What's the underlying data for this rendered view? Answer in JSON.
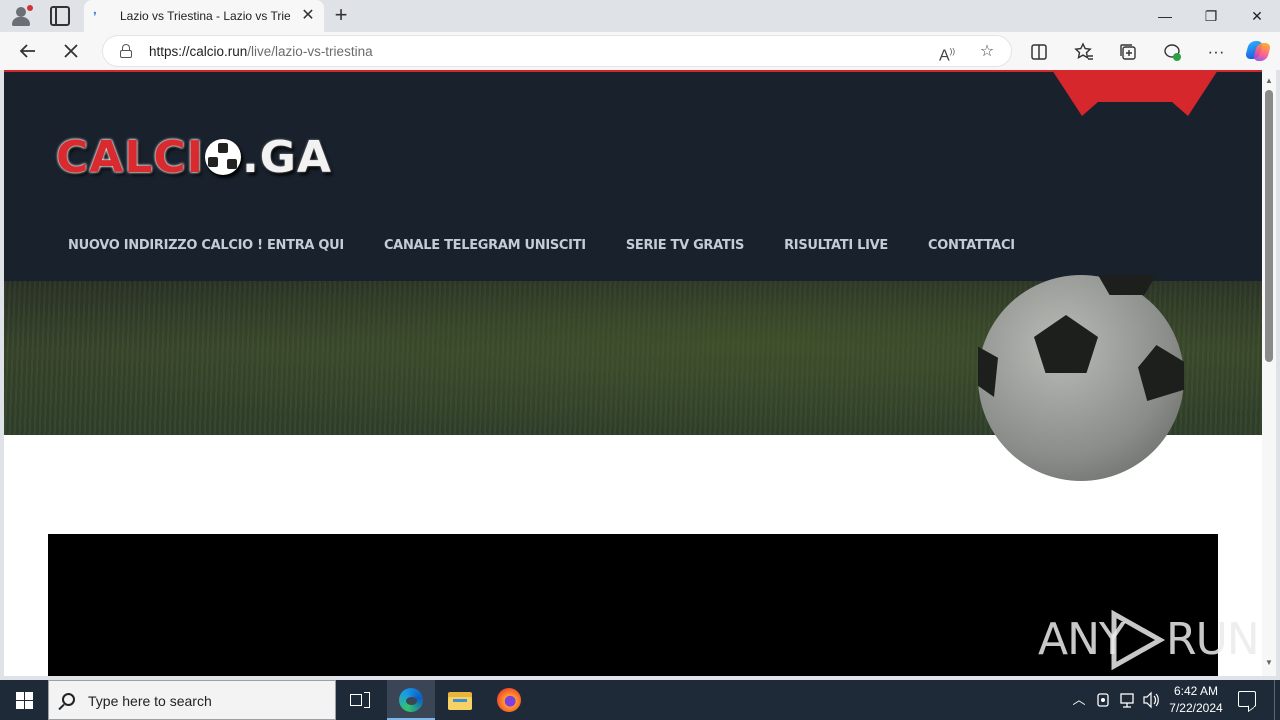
{
  "browser": {
    "tab_title": "Lazio vs Triestina - Lazio vs Triestina",
    "url_domain": "https://calcio.run",
    "url_path": "/live/lazio-vs-triestina",
    "new_tab_symbol": "+",
    "close_tab_symbol": "✕",
    "window_controls": {
      "minimize": "—",
      "restore": "❐",
      "close": "✕"
    }
  },
  "site": {
    "logo": {
      "part1": "CALCI",
      "part2": ".GA"
    },
    "nav": [
      {
        "label": "NUOVO INDIRIZZO CALCIO ! ENTRA QUI"
      },
      {
        "label": "CANALE TELEGRAM UNISCITI"
      },
      {
        "label": "SERIE TV GRATIS"
      },
      {
        "label": "RISULTATI LIVE"
      },
      {
        "label": "CONTATTACI"
      }
    ],
    "colors": {
      "header_bg": "#19212d",
      "accent_red": "#d0262c",
      "nav_text": "#c4ccd6"
    }
  },
  "watermark": {
    "text_left": "ANY",
    "text_right": "RUN"
  },
  "taskbar": {
    "search_placeholder": "Type here to search",
    "time": "6:42 AM",
    "date": "7/22/2024"
  },
  "icons": {
    "back": "back-arrow-icon",
    "reload": "stop-loading-icon",
    "read_aloud": "read-aloud-icon",
    "favorite": "star-icon",
    "split": "split-screen-icon",
    "favorites": "favorites-icon",
    "collections": "collections-icon",
    "extensions": "browser-essentials-icon",
    "more": "more-icon",
    "copilot": "copilot-icon"
  }
}
